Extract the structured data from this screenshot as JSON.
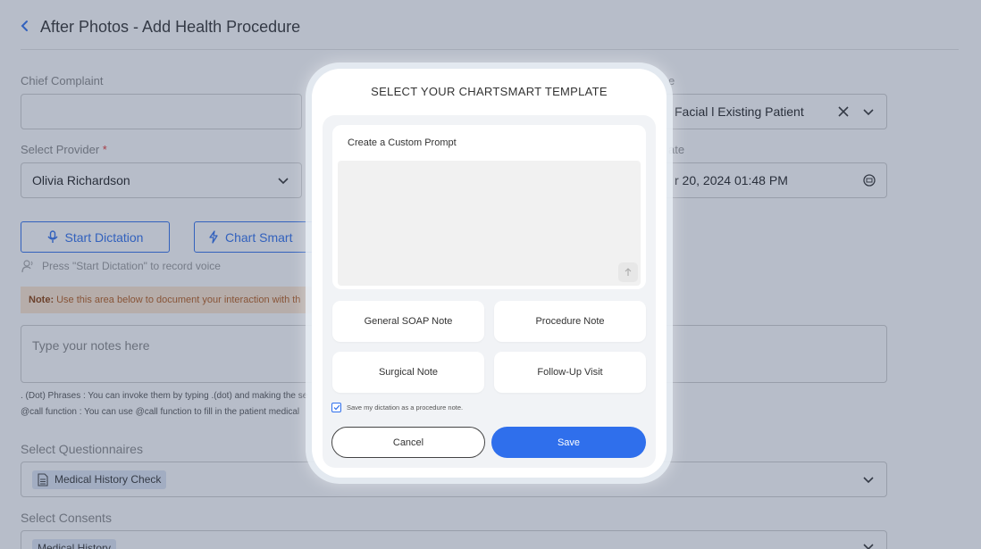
{
  "header": {
    "back_icon": "chevron-left-icon",
    "title": "After Photos - Add Health Procedure"
  },
  "form": {
    "chief_complaint_label": "Chief Complaint",
    "chief_complaint_value": "",
    "template_label_partial": "e",
    "template_value": "Facial l Existing Patient",
    "provider_label": "Select Provider",
    "provider_required": "*",
    "provider_value": "Olivia Richardson",
    "date_label_partial": "ate",
    "date_value": "r 20, 2024 01:48 PM",
    "start_dictation_label": "Start Dictation",
    "chart_smart_label": "Chart Smart",
    "dictation_hint": "Press \"Start Dictation\" to record voice",
    "note_prefix": "Note:",
    "note_text": "Use this area below to document your interaction with th",
    "notes_placeholder": "Type your notes here",
    "dot_phrases_text": ". (Dot) Phrases : You can invoke them by typing .(dot) and making the se",
    "call_function_text": "@call function : You can use @call function to fill in the patient medical",
    "questionnaires_label": "Select Questionnaires",
    "questionnaire_chip": "Medical History Check",
    "consents_label": "Select Consents",
    "consent_chip": "Medical History"
  },
  "modal": {
    "title": "SELECT YOUR CHARTSMART TEMPLATE",
    "custom_prompt_label": "Create a Custom Prompt",
    "custom_prompt_value": "",
    "templates": [
      "General SOAP Note",
      "Procedure Note",
      "Surgical Note",
      "Follow-Up Visit"
    ],
    "save_checkbox_label": "Save my dictation as a procedure note.",
    "save_checkbox_checked": true,
    "cancel_label": "Cancel",
    "save_label": "Save"
  },
  "colors": {
    "accent": "#2f6fec",
    "overlay": "#374869",
    "note_bg": "#fde6cf",
    "required": "#e53935"
  }
}
